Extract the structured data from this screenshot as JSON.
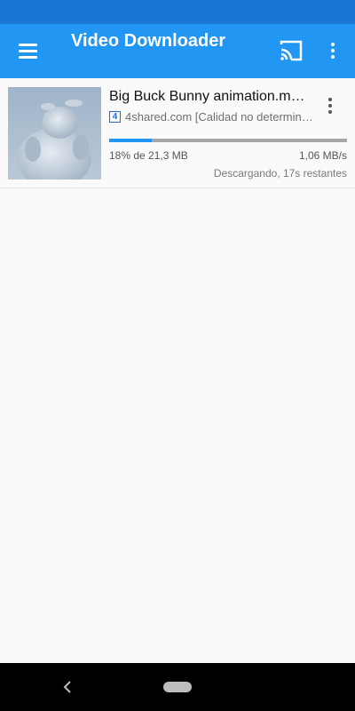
{
  "app_bar": {
    "title": "Video Downloader",
    "menu_icon": "hamburger-menu-icon",
    "cast_icon": "cast-icon",
    "more_icon": "more-vert-icon",
    "color": "#2196f3",
    "status_color": "#1976d2"
  },
  "downloads": [
    {
      "title": "Big Buck Bunny animation.m…",
      "source_icon": "4shared-icon",
      "source_icon_letter": "4",
      "source": "4shared.com [Calidad no determinada]",
      "progress_percent": 18,
      "progress_text": "18% de 21,3 MB",
      "speed": "1,06 MB/s",
      "status": "Descargando, 17s restantes"
    }
  ],
  "nav": {
    "back_icon": "back-chevron-icon",
    "home_icon": "home-pill-icon"
  }
}
